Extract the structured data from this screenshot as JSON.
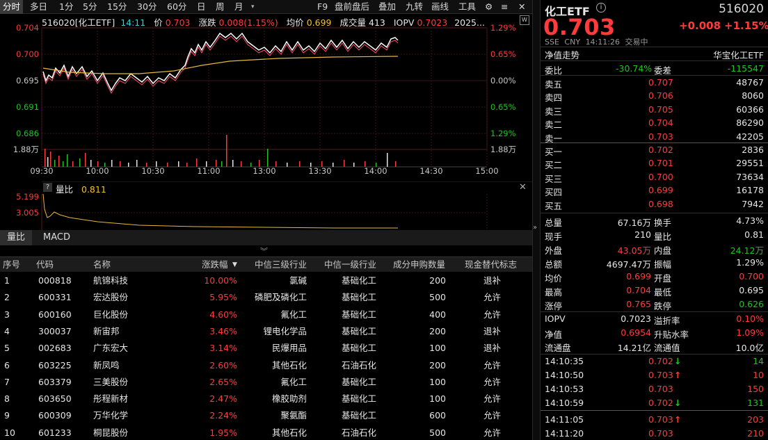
{
  "toolbar": {
    "periods": [
      "分时",
      "多日",
      "1分",
      "5分",
      "15分",
      "30分",
      "60分",
      "日",
      "周",
      "月"
    ],
    "tools": [
      "F9",
      "盘前盘后",
      "叠加",
      "九转",
      "画线",
      "工具"
    ]
  },
  "chart": {
    "code_name": "516020[化工ETF]",
    "time": "14:11",
    "price_label": "价",
    "price": "0.703",
    "chg_label": "涨跌",
    "chg": "0.008(1.15%)",
    "avg_label": "均价",
    "avg": "0.699",
    "vol_label": "成交量",
    "vol": "413",
    "iopv_label": "IOPV",
    "iopv": "0.7023",
    "date": "2025...",
    "y_left": [
      "0.704",
      "0.700",
      "0.695",
      "0.691",
      "0.686",
      "1.88万"
    ],
    "y_right": [
      "1.29%",
      "0.65%",
      "0.00%",
      "0.65%",
      "1.29%",
      "1.88万"
    ],
    "x_labels": [
      "09:30",
      "10:00",
      "10:30",
      "11:00",
      "13:00",
      "13:30",
      "14:00",
      "14:30",
      "15:00"
    ],
    "colors": {
      "price": "#ffffff",
      "avg": "#e8b93a",
      "up": "#ff3b3b",
      "down": "#22c222",
      "grid": "#3a1414"
    }
  },
  "sub_chart": {
    "label": "量比",
    "value": "0.811",
    "y_labels": [
      "5.199",
      "3.005"
    ]
  },
  "tabs": [
    "量比",
    "MACD"
  ],
  "table": {
    "headers": [
      "序号",
      "代码",
      "名称",
      "涨跌幅",
      "中信三级行业",
      "中信一级行业",
      "成分申购数量",
      "现金替代标志"
    ],
    "rows": [
      [
        "1",
        "000818",
        "航锦科技",
        "10.00%",
        "氯碱",
        "基础化工",
        "200",
        "退补"
      ],
      [
        "2",
        "600331",
        "宏达股份",
        "5.95%",
        "磷肥及磷化工",
        "基础化工",
        "500",
        "允许"
      ],
      [
        "3",
        "600160",
        "巨化股份",
        "4.60%",
        "氟化工",
        "基础化工",
        "400",
        "允许"
      ],
      [
        "4",
        "300037",
        "新宙邦",
        "3.46%",
        "锂电化学品",
        "基础化工",
        "200",
        "退补"
      ],
      [
        "5",
        "002683",
        "广东宏大",
        "3.14%",
        "民爆用品",
        "基础化工",
        "100",
        "退补"
      ],
      [
        "6",
        "603225",
        "新凤鸣",
        "2.60%",
        "其他石化",
        "石油石化",
        "200",
        "允许"
      ],
      [
        "7",
        "603379",
        "三美股份",
        "2.65%",
        "氟化工",
        "基础化工",
        "100",
        "允许"
      ],
      [
        "8",
        "603650",
        "彤程新材",
        "2.47%",
        "橡胶助剂",
        "基础化工",
        "100",
        "允许"
      ],
      [
        "9",
        "600309",
        "万华化学",
        "2.24%",
        "聚氨酯",
        "基础化工",
        "600",
        "允许"
      ],
      [
        "10",
        "601233",
        "桐昆股份",
        "1.95%",
        "其他石化",
        "石油石化",
        "500",
        "允许"
      ]
    ]
  },
  "panel": {
    "name": "化工ETF",
    "code": "516020",
    "price": "0.703",
    "chg": "+0.008",
    "pct": "+1.15%",
    "market": "SSE",
    "currency": "CNY",
    "time": "14:11:26",
    "status": "交易中",
    "nav_trend": "净值走势",
    "fund_co": "华宝化工ETF",
    "weibi_label": "委比",
    "weibi": "-30.74%",
    "weicha_label": "委差",
    "weicha": "-115547",
    "asks": [
      {
        "label": "卖五",
        "price": "0.707",
        "vol": "48767"
      },
      {
        "label": "卖四",
        "price": "0.706",
        "vol": "8060"
      },
      {
        "label": "卖三",
        "price": "0.705",
        "vol": "60366"
      },
      {
        "label": "卖二",
        "price": "0.704",
        "vol": "86290"
      },
      {
        "label": "卖一",
        "price": "0.703",
        "vol": "42205"
      }
    ],
    "bids": [
      {
        "label": "买一",
        "price": "0.702",
        "vol": "2836"
      },
      {
        "label": "买二",
        "price": "0.701",
        "vol": "29551"
      },
      {
        "label": "买三",
        "price": "0.700",
        "vol": "73634"
      },
      {
        "label": "买四",
        "price": "0.699",
        "vol": "16178"
      },
      {
        "label": "买五",
        "price": "0.698",
        "vol": "7942"
      }
    ],
    "stats": [
      [
        "总量",
        "67.16万",
        "换手",
        "4.73%"
      ],
      [
        "现手",
        "210",
        "量比",
        "0.81"
      ],
      [
        "外盘",
        "43.05万",
        "内盘",
        "24.12万"
      ],
      [
        "总额",
        "4697.47万",
        "振幅",
        "1.29%"
      ],
      [
        "均价",
        "0.699",
        "开盘",
        "0.700"
      ],
      [
        "最高",
        "0.704",
        "最低",
        "0.695"
      ],
      [
        "涨停",
        "0.765",
        "跌停",
        "0.626"
      ]
    ],
    "stats2": [
      [
        "IOPV",
        "0.7023",
        "溢折率",
        "0.10%"
      ],
      [
        "净值",
        "0.6954",
        "升贴水率",
        "1.09%"
      ],
      [
        "流通盘",
        "14.21亿",
        "流通值",
        "10.0亿"
      ]
    ],
    "ticks": [
      {
        "time": "14:10:35",
        "price": "0.702",
        "dir": "↓",
        "vol": "14"
      },
      {
        "time": "14:10:50",
        "price": "0.703",
        "dir": "↑",
        "vol": "10"
      },
      {
        "time": "14:10:53",
        "price": "0.703",
        "dir": "",
        "vol": "150"
      },
      {
        "time": "14:10:59",
        "price": "0.702",
        "dir": "↓",
        "vol": "131"
      },
      {
        "time": "14:11:05",
        "price": "0.703",
        "dir": "↑",
        "vol": "203"
      },
      {
        "time": "14:11:20",
        "price": "0.703",
        "dir": "",
        "vol": "210"
      }
    ]
  }
}
